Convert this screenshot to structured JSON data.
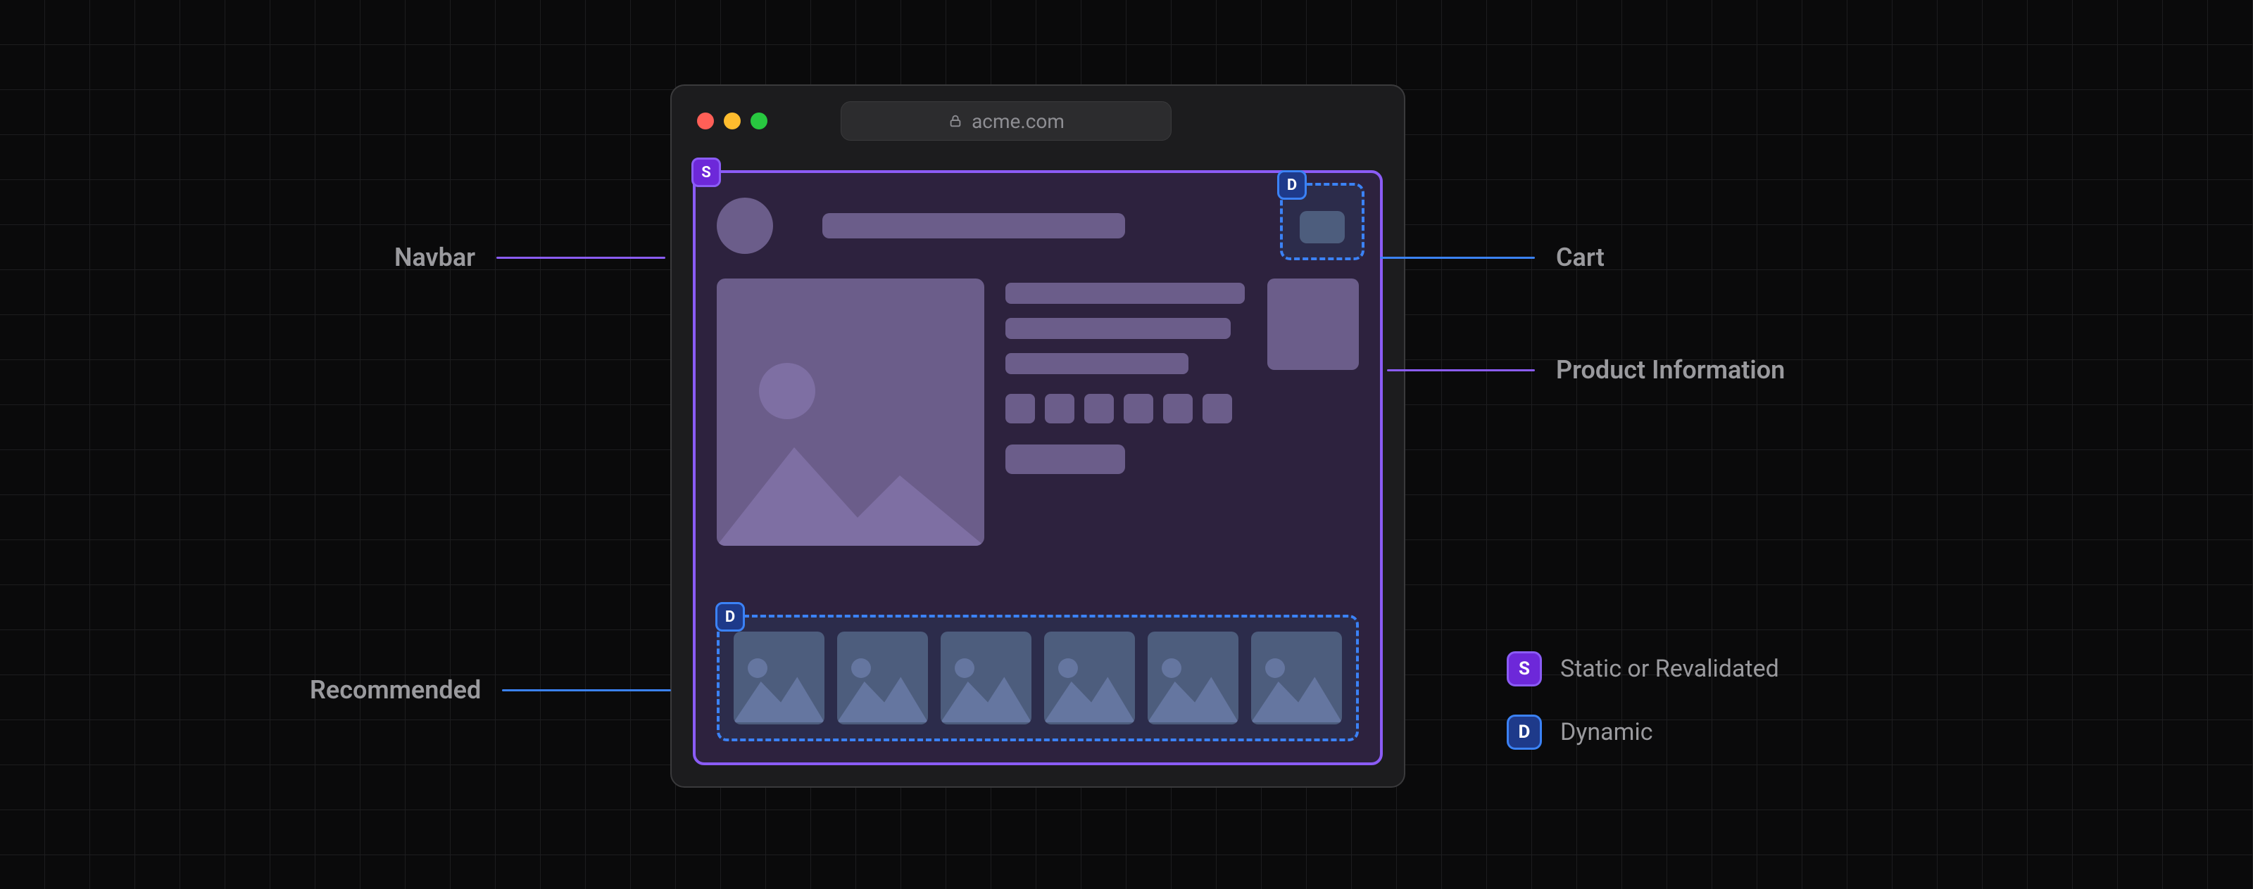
{
  "browser": {
    "address": "acme.com"
  },
  "badges": {
    "static": "S",
    "dynamic": "D"
  },
  "callouts": {
    "navbar": "Navbar",
    "cart": "Cart",
    "product_info": "Product Information",
    "recommended": "Recommended"
  },
  "legend": {
    "static": "Static or Revalidated",
    "dynamic": "Dynamic"
  }
}
